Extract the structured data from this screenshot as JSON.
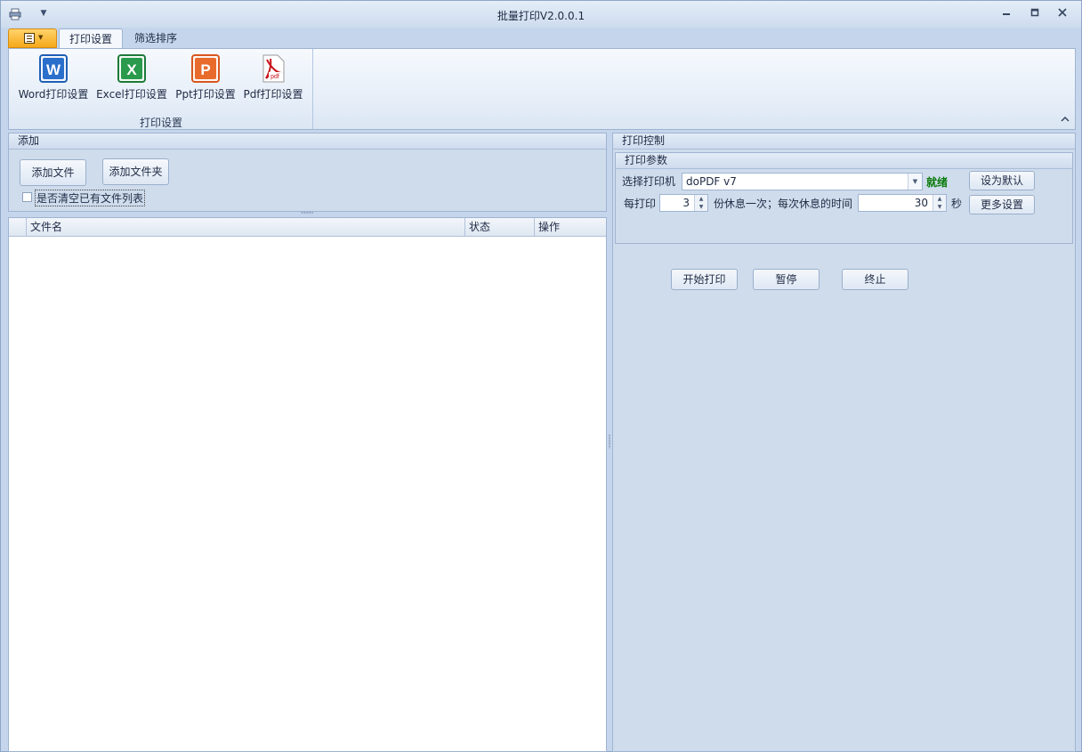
{
  "window": {
    "title": "批量打印V2.0.0.1",
    "controls": [
      "minimize",
      "restore",
      "close"
    ]
  },
  "ribbon": {
    "tabs": [
      {
        "label": "打印设置",
        "active": true
      },
      {
        "label": "筛选排序",
        "active": false
      }
    ],
    "group": {
      "label": "打印设置",
      "buttons": [
        {
          "label": "Word打印设置",
          "icon": "word-icon",
          "color": "#1f5fb4"
        },
        {
          "label": "Excel打印设置",
          "icon": "excel-icon",
          "color": "#1d7a3a"
        },
        {
          "label": "Ppt打印设置",
          "icon": "powerpoint-icon",
          "color": "#d8561f"
        },
        {
          "label": "Pdf打印设置",
          "icon": "pdf-icon",
          "color": "#c8161d"
        }
      ]
    }
  },
  "add_panel": {
    "title": "添加",
    "add_file": "添加文件",
    "add_folder": "添加文件夹",
    "clear_checkbox_label": "是否清空已有文件列表",
    "clear_checked": false
  },
  "file_grid": {
    "columns": [
      "文件名",
      "状态",
      "操作"
    ],
    "rows": []
  },
  "print_control": {
    "title": "打印控制",
    "params_title": "打印参数",
    "printer_label": "选择打印机",
    "printer_value": "doPDF v7",
    "status": "就绪",
    "status_color": "#0a7a0a",
    "set_default": "设为默认",
    "copies_prefix": "每打印",
    "copies_value": "3",
    "copies_suffix": "份休息一次；每次休息的时间",
    "rest_value": "30",
    "rest_unit": "秒",
    "more_settings": "更多设置",
    "start": "开始打印",
    "pause": "暂停",
    "stop": "终止"
  }
}
